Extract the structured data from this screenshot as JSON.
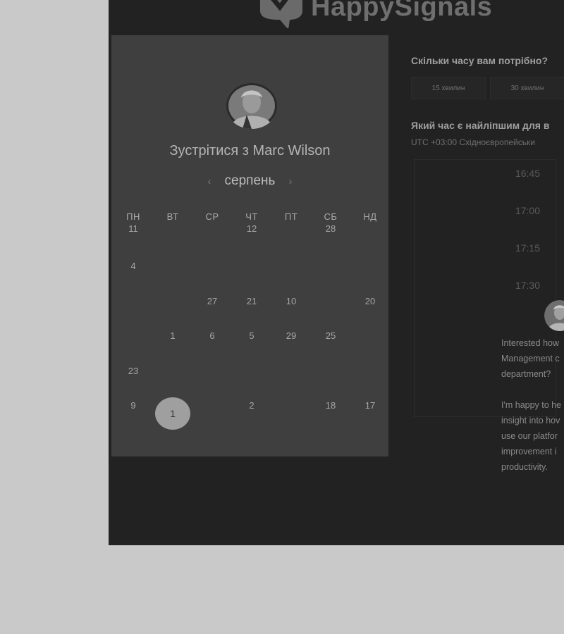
{
  "brand": {
    "name": "HappySignals"
  },
  "left": {
    "meet_title": "Зустрітися з Marc Wilson",
    "month": "серпень",
    "prev_icon": "chevron-left-icon",
    "next_icon": "chevron-right-icon",
    "weekdays": [
      "ПН",
      "ВТ",
      "СР",
      "ЧТ",
      "ПТ",
      "СБ",
      "НД"
    ],
    "weeks": [
      [
        {
          "t": "11",
          "d": false
        },
        {
          "t": "",
          "d": true
        },
        {
          "t": "",
          "d": true
        },
        {
          "t": "12",
          "d": false
        },
        {
          "t": "",
          "d": true
        },
        {
          "t": "28",
          "d": false
        },
        {
          "t": "",
          "d": true
        }
      ],
      [
        {
          "t": "4",
          "d": false
        },
        {
          "t": "",
          "d": true
        },
        {
          "t": "",
          "d": true
        },
        {
          "t": "",
          "d": true
        },
        {
          "t": "",
          "d": true
        },
        {
          "t": "",
          "d": true
        },
        {
          "t": "",
          "d": true
        }
      ],
      [
        {
          "t": "",
          "d": true
        },
        {
          "t": "",
          "d": true
        },
        {
          "t": "27",
          "d": false
        },
        {
          "t": "21",
          "d": false
        },
        {
          "t": "10",
          "d": false
        },
        {
          "t": "",
          "d": true
        },
        {
          "t": "20",
          "d": false
        }
      ],
      [
        {
          "t": "",
          "d": true
        },
        {
          "t": "1",
          "d": false
        },
        {
          "t": "6",
          "d": false
        },
        {
          "t": "5",
          "d": false
        },
        {
          "t": "29",
          "d": false
        },
        {
          "t": "25",
          "d": false
        },
        {
          "t": "",
          "d": true
        }
      ],
      [
        {
          "t": "23",
          "d": false
        },
        {
          "t": "",
          "d": true
        },
        {
          "t": "",
          "d": true
        },
        {
          "t": "",
          "d": true
        },
        {
          "t": "",
          "d": true
        },
        {
          "t": "",
          "d": true
        },
        {
          "t": "",
          "d": true
        }
      ],
      [
        {
          "t": "9",
          "d": false
        },
        {
          "t": "1",
          "d": false,
          "selected": true
        },
        {
          "t": "",
          "d": true
        },
        {
          "t": "2",
          "d": false
        },
        {
          "t": "",
          "d": true
        },
        {
          "t": "18",
          "d": false
        },
        {
          "t": "17",
          "d": false
        }
      ]
    ]
  },
  "right": {
    "duration_question": "Скільки часу вам потрібно?",
    "durations": [
      "15 хвилин",
      "30 хвилин"
    ],
    "time_question": "Який час є найліпшим для в",
    "timezone": "UTC +03:00 Східноєвропейськи",
    "slots": [
      "16:45",
      "17:00",
      "17:15",
      "17:30"
    ]
  },
  "chat": {
    "lines": [
      "Interested how",
      "Management c",
      "department?",
      "",
      "I'm happy to he",
      "insight into hov",
      "use our platfor",
      "improvement i",
      "productivity."
    ]
  }
}
